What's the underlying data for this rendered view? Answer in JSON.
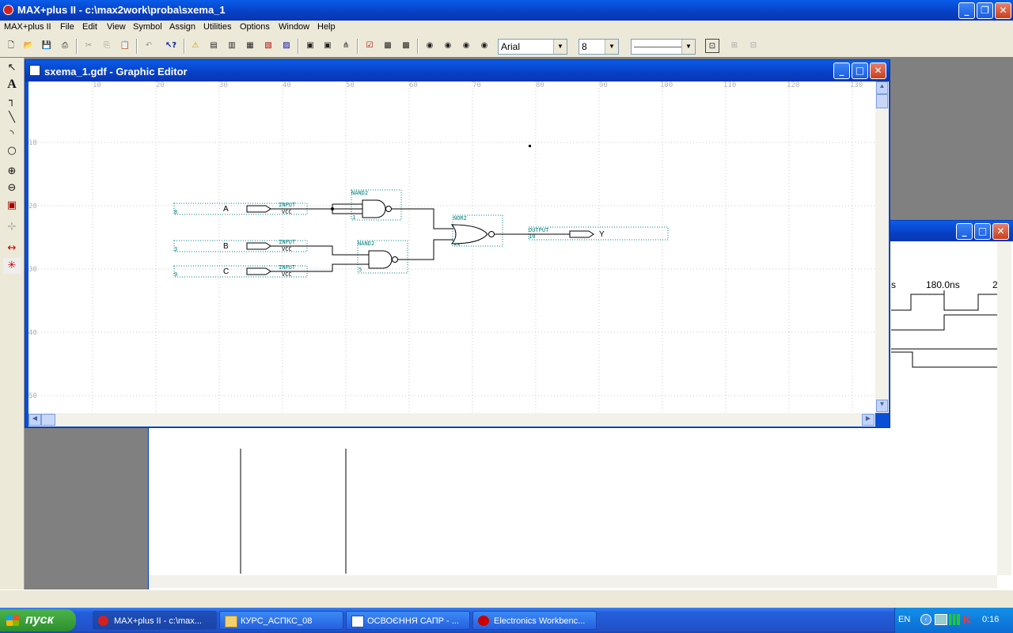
{
  "app": {
    "title": "MAX+plus II - c:\\max2work\\proba\\sxema_1"
  },
  "menu": [
    "MAX+plus II",
    "File",
    "Edit",
    "View",
    "Symbol",
    "Assign",
    "Utilities",
    "Options",
    "Window",
    "Help"
  ],
  "toolbar": {
    "font_name": "Arial",
    "font_size": "8",
    "line_style": "──────────"
  },
  "editor": {
    "title": "sxema_1.gdf - Graphic Editor",
    "ruler_top": [
      "10",
      "20",
      "30",
      "40",
      "50",
      "60",
      "70",
      "80",
      "90",
      "100",
      "110",
      "120",
      "130"
    ],
    "ruler_left": [
      "10",
      "20",
      "30",
      "40",
      "50"
    ],
    "pins": [
      {
        "name": "A",
        "type": "INPUT",
        "sub": "VCC",
        "num": "8"
      },
      {
        "name": "B",
        "type": "INPUT",
        "sub": "VCC",
        "num": "3"
      },
      {
        "name": "C",
        "type": "INPUT",
        "sub": "VCC",
        "num": "9"
      },
      {
        "name": "Y",
        "type": "OUTPUT",
        "num": "10"
      }
    ],
    "gates": [
      {
        "type": "NAND2",
        "num": "1"
      },
      {
        "type": "NAND2",
        "num": "5"
      },
      {
        "type": "NOR2",
        "num": "11"
      }
    ]
  },
  "wave": {
    "time_labels": [
      "s",
      "180.0ns",
      "2"
    ]
  },
  "taskbar": {
    "start_label": "пуск",
    "tasks": [
      "MAX+plus II - c:\\max...",
      "КУРС_АСПКС_08",
      "ОСВОЄННЯ САПР - ...",
      "Electronics Workbenc..."
    ],
    "lang": "EN",
    "clock": "0:16"
  },
  "colors": {
    "title_blue": "#0a5ce8",
    "schematic_cyan": "#008080",
    "chrome": "#ece9d8"
  }
}
